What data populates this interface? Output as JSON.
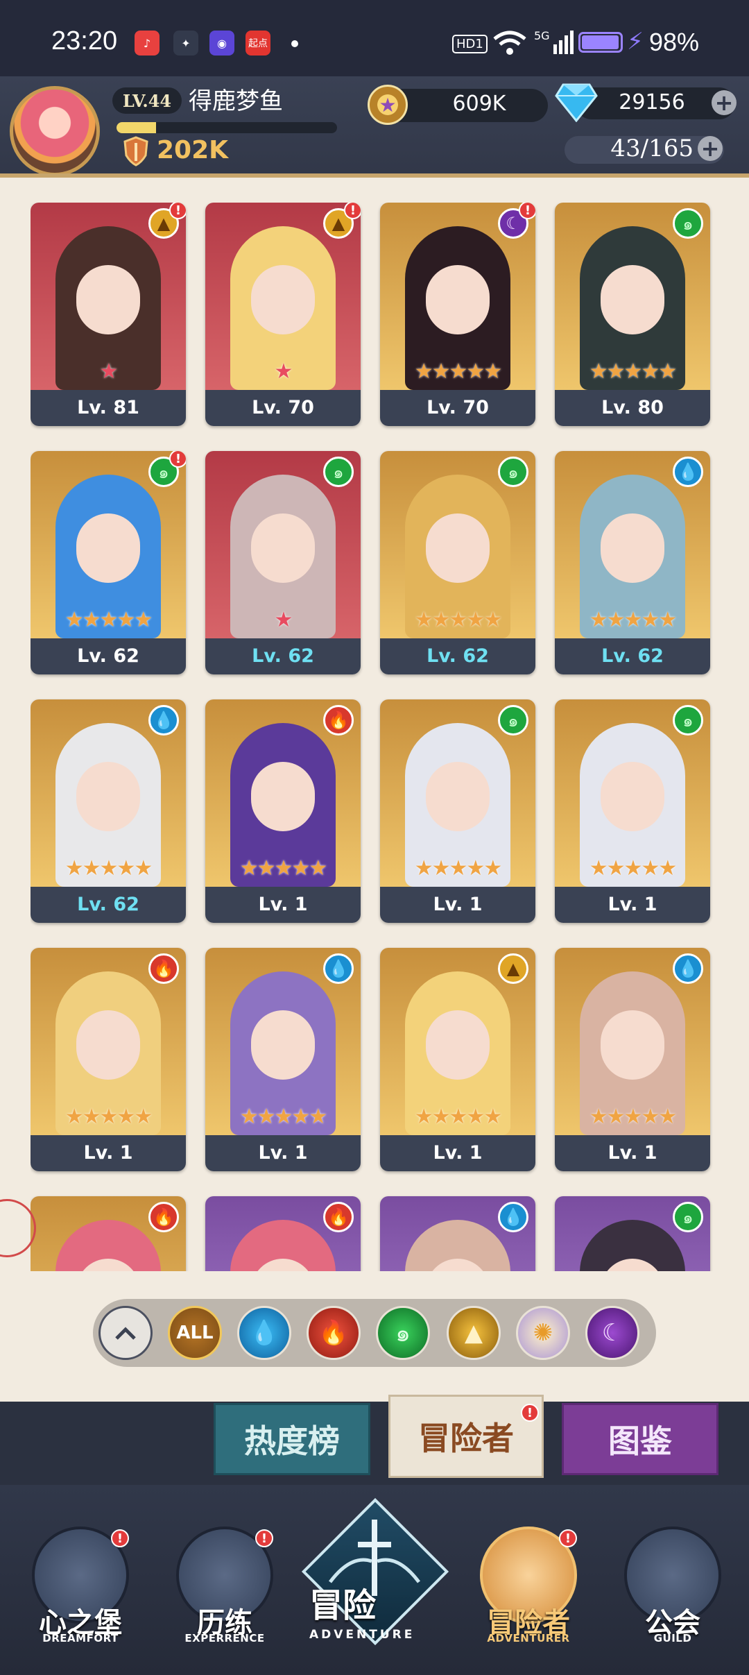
{
  "status_bar": {
    "time": "23:20",
    "hd": "HD1",
    "signal": "5G",
    "battery_percent": "98%",
    "battery_level": 0.98,
    "apps": [
      {
        "icon": "music-app-icon",
        "color": "#e8413f",
        "glyph": "♪"
      },
      {
        "icon": "game-app-icon",
        "color": "#333a4c",
        "glyph": "✦"
      },
      {
        "icon": "browser-app-icon",
        "color": "#5b45d6",
        "glyph": "◉"
      },
      {
        "icon": "reader-app-icon",
        "color": "#e23530",
        "glyph": "起点"
      }
    ]
  },
  "header": {
    "level": "LV.44",
    "player_name": "得鹿梦鱼",
    "exp_fraction": 0.18,
    "power": "202K",
    "gold": "609K",
    "gems": "29156",
    "hero_count": "43/165"
  },
  "heroes": [
    {
      "level": "Lv. 81",
      "element": "earth",
      "alert": true,
      "stars": 1,
      "bg": "red",
      "hair": "#4a2f2a",
      "level_color": "white"
    },
    {
      "level": "Lv. 70",
      "element": "earth",
      "alert": true,
      "stars": 1,
      "bg": "red",
      "hair": "#f3d27a",
      "level_color": "white"
    },
    {
      "level": "Lv. 70",
      "element": "dark",
      "alert": true,
      "stars": 5,
      "bg": "gold",
      "hair": "#2c1c22",
      "level_color": "white"
    },
    {
      "level": "Lv. 80",
      "element": "wind",
      "alert": false,
      "stars": 5,
      "bg": "gold",
      "hair": "#2f3a3a",
      "level_color": "white"
    },
    {
      "level": "Lv. 62",
      "element": "wind",
      "alert": true,
      "stars": 5,
      "bg": "gold",
      "hair": "#3f8ee0",
      "level_color": "white"
    },
    {
      "level": "Lv. 62",
      "element": "wind",
      "alert": false,
      "stars": 1,
      "bg": "red",
      "hair": "#cdb6b6",
      "level_color": "cyan"
    },
    {
      "level": "Lv. 62",
      "element": "wind",
      "alert": false,
      "stars": 5,
      "bg": "gold",
      "hair": "#e2b45a",
      "level_color": "cyan"
    },
    {
      "level": "Lv. 62",
      "element": "water",
      "alert": false,
      "stars": 5,
      "bg": "gold",
      "hair": "#8fb6c6",
      "level_color": "cyan"
    },
    {
      "level": "Lv. 62",
      "element": "water",
      "alert": false,
      "stars": 5,
      "bg": "gold",
      "hair": "#e8e8ea",
      "level_color": "cyan"
    },
    {
      "level": "Lv. 1",
      "element": "fire",
      "alert": false,
      "stars": 5,
      "bg": "gold",
      "hair": "#5b3a9a",
      "level_color": "white"
    },
    {
      "level": "Lv. 1",
      "element": "wind",
      "alert": false,
      "stars": 5,
      "bg": "gold",
      "hair": "#e4e6ee",
      "level_color": "white"
    },
    {
      "level": "Lv. 1",
      "element": "wind",
      "alert": false,
      "stars": 5,
      "bg": "gold",
      "hair": "#e4e6ee",
      "level_color": "white"
    },
    {
      "level": "Lv. 1",
      "element": "fire",
      "alert": false,
      "stars": 5,
      "bg": "gold",
      "hair": "#f0cf7e",
      "level_color": "white"
    },
    {
      "level": "Lv. 1",
      "element": "water",
      "alert": false,
      "stars": 5,
      "bg": "gold",
      "hair": "#8d73c2",
      "level_color": "white"
    },
    {
      "level": "Lv. 1",
      "element": "earth",
      "alert": false,
      "stars": 5,
      "bg": "gold",
      "hair": "#f3d27a",
      "level_color": "white"
    },
    {
      "level": "Lv. 1",
      "element": "water",
      "alert": false,
      "stars": 5,
      "bg": "gold",
      "hair": "#d9b3a2",
      "level_color": "white"
    },
    {
      "level": "",
      "element": "fire",
      "alert": false,
      "stars": 0,
      "bg": "gold",
      "hair": "#e36a80",
      "level_color": "white"
    },
    {
      "level": "",
      "element": "fire",
      "alert": false,
      "stars": 0,
      "bg": "purple",
      "hair": "#e36a80",
      "level_color": "white"
    },
    {
      "level": "",
      "element": "water",
      "alert": false,
      "stars": 0,
      "bg": "purple",
      "hair": "#d9b3a2",
      "level_color": "white"
    },
    {
      "level": "",
      "element": "wind",
      "alert": false,
      "stars": 0,
      "bg": "purple",
      "hair": "#3a3040",
      "level_color": "white"
    }
  ],
  "filters": [
    {
      "name": "collapse",
      "label": ""
    },
    {
      "name": "all",
      "label": "ALL"
    },
    {
      "name": "water",
      "label": ""
    },
    {
      "name": "fire",
      "label": ""
    },
    {
      "name": "wind",
      "label": ""
    },
    {
      "name": "earth",
      "label": ""
    },
    {
      "name": "light",
      "label": ""
    },
    {
      "name": "dark",
      "label": ""
    }
  ],
  "tabs": {
    "popularity": "热度榜",
    "adventurer": "冒险者",
    "codex": "图鉴"
  },
  "nav": [
    {
      "label": "心之堡",
      "sub": "DREAMFORT",
      "badge": true
    },
    {
      "label": "历练",
      "sub": "EXPERRENCE",
      "badge": true
    },
    {
      "label": "冒险",
      "sub": "ADVENTURE",
      "badge": false
    },
    {
      "label": "冒险者",
      "sub": "ADVENTURER",
      "badge": true
    },
    {
      "label": "公会",
      "sub": "GUILD",
      "badge": false
    }
  ]
}
